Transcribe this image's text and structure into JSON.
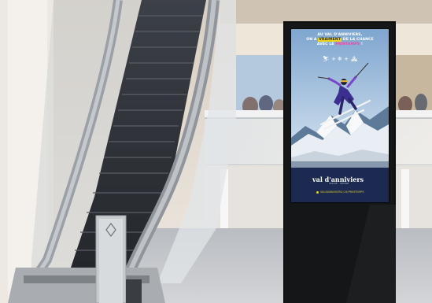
{
  "photo": {
    "description_colors": {
      "sky_top": "#8ab0d3",
      "sky_bottom": "#dbe7f1",
      "poster_band": "#1c2a52",
      "kiosk_body": "#0d0d0d",
      "floor": "#c7c9cd"
    }
  },
  "poster": {
    "headline_line1": "AU VAL D'ANNIVIERS,",
    "headline_line2_pre": "ON A ",
    "headline_highlight": "VRAIMENT",
    "headline_line2_post": " DE LA CHANCE",
    "headline_line3_pre": "AVEC LE ",
    "headline_pink": "PRINTEMPS",
    "headline_line3_post": " !",
    "icons_text": "⛷ + ❄ + ⛰",
    "brand_name": "val d'anniviers",
    "brand_tagline": "VALAIS · SUISSE",
    "url_text": "VALDANNIVIERS.CH/PRINTEMPS"
  }
}
